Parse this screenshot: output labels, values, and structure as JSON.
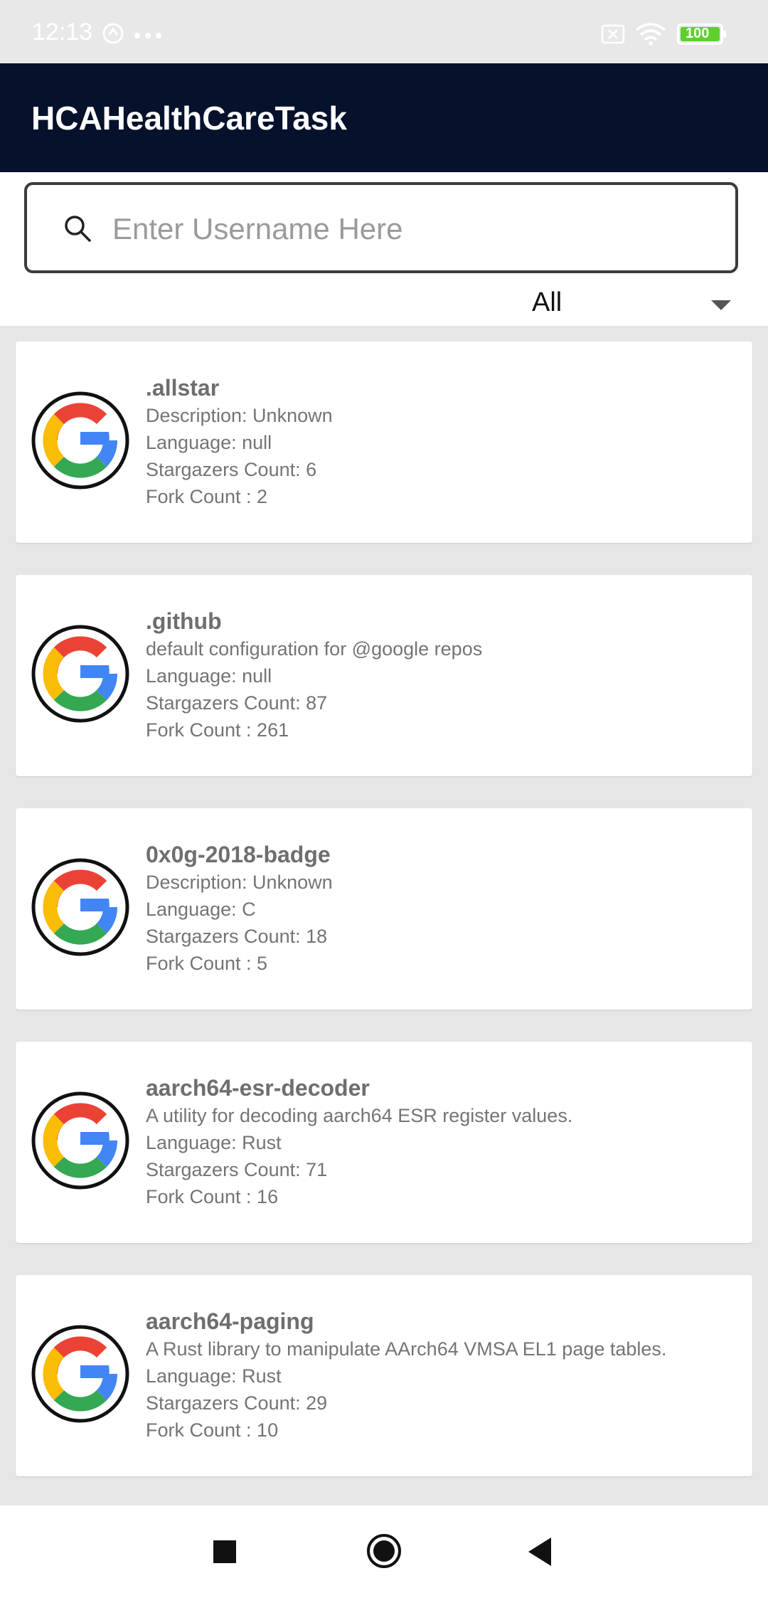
{
  "status_bar": {
    "time": "12:13",
    "battery": "100",
    "icons": [
      "notification-icon",
      "more-dots-icon",
      "sim-off-icon",
      "wifi-icon",
      "battery-icon"
    ]
  },
  "app_bar": {
    "title": "HCAHealthCareTask"
  },
  "search": {
    "placeholder": "Enter Username Here",
    "value": ""
  },
  "filter": {
    "selected": "All"
  },
  "repos": [
    {
      "name": ".allstar",
      "description": "Description: Unknown",
      "language": "Language: null",
      "stars": "Stargazers Count: 6",
      "forks": "Fork Count : 2"
    },
    {
      "name": ".github",
      "description": "default configuration for @google repos",
      "language": "Language: null",
      "stars": "Stargazers Count: 87",
      "forks": "Fork Count : 261"
    },
    {
      "name": "0x0g-2018-badge",
      "description": "Description: Unknown",
      "language": "Language: C",
      "stars": "Stargazers Count: 18",
      "forks": "Fork Count : 5"
    },
    {
      "name": "aarch64-esr-decoder",
      "description": "A utility for decoding aarch64 ESR register values.",
      "language": "Language: Rust",
      "stars": "Stargazers Count: 71",
      "forks": "Fork Count : 16"
    },
    {
      "name": "aarch64-paging",
      "description": "A Rust library to manipulate AArch64 VMSA EL1 page tables.",
      "language": "Language: Rust",
      "stars": "Stargazers Count: 29",
      "forks": "Fork Count : 10"
    }
  ],
  "nav_bar": {
    "buttons": [
      "recents-square-icon",
      "home-circle-icon",
      "back-triangle-icon"
    ]
  },
  "colors": {
    "app_bar": "#06122c",
    "background": "#e6e6e6",
    "card": "#ffffff"
  }
}
